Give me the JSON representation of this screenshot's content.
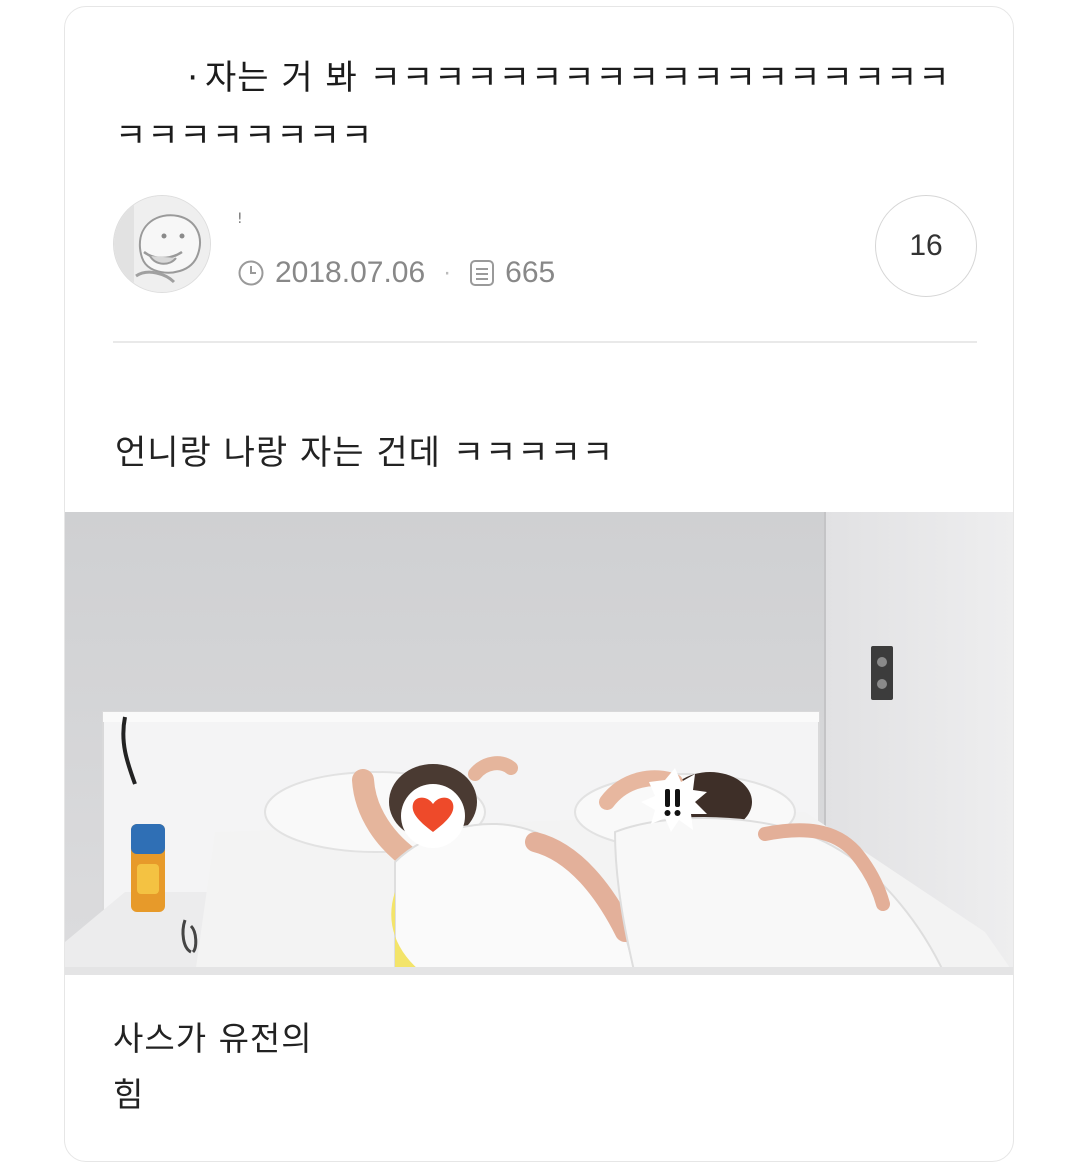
{
  "post": {
    "title_dot": "·",
    "title_text": "자는 거 봐 ㅋㅋㅋㅋㅋㅋㅋㅋㅋㅋㅋㅋㅋㅋㅋㅋㅋㅋㅋㅋㅋㅋㅋㅋㅋㅋ",
    "author_name": "!",
    "date": "2018.07.06",
    "separator": "·",
    "views": "665",
    "comment_count": "16",
    "body_line": "언니랑 나랑 자는 건데 ㅋㅋㅋㅋㅋ",
    "caption_line1": "사스가 유전의",
    "caption_line2": "힘"
  },
  "icons": {
    "date": "clock-icon",
    "views": "document-icon",
    "sticker_left": "heart-icon",
    "sticker_right": "exclamation-icon"
  },
  "colors": {
    "heart": "#ee4a2a",
    "meta_text": "#888888",
    "border": "#e6e6e6"
  }
}
